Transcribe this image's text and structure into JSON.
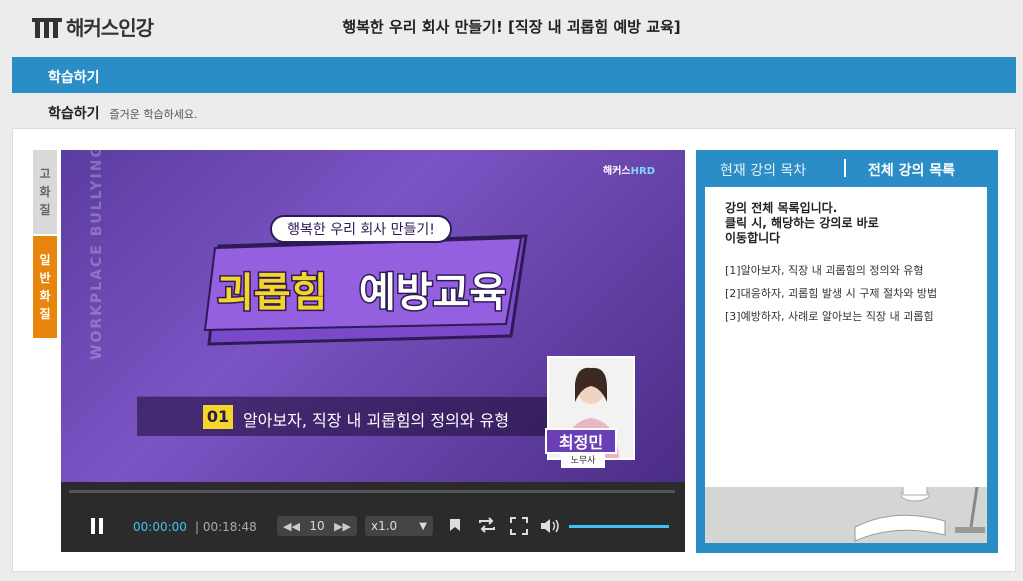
{
  "header": {
    "logo_text": "해커스인강",
    "title": "행복한 우리 회사 만들기! [직장 내 괴롭힘 예방 교육]"
  },
  "bluebar": {
    "label": "학습하기"
  },
  "subhead": {
    "title": "학습하기",
    "desc": "즐거운 학습하세요."
  },
  "quality": {
    "high": [
      "고",
      "화",
      "질"
    ],
    "normal": [
      "일",
      "반",
      "화",
      "질"
    ]
  },
  "video": {
    "slate_subtitle": "행복한 우리 회사 만들기!",
    "slate_title_part1": "괴롭힘",
    "slate_title_part2": "예방교육",
    "hrd_brand": "해커스",
    "hrd_accent": "HRD",
    "side_text": "WORKPLACE BULLYING",
    "lesson_number": "01",
    "lesson_title": "알아보자, 직장 내 괴롭힘의 정의와 유형",
    "presenter_name": "최정민",
    "presenter_role": "노무사"
  },
  "controls": {
    "current_time": "00:00:00",
    "duration": "| 00:18:48",
    "skip_seconds": "10",
    "speed": "x1.0",
    "progress": 0.0,
    "volume": 1.0
  },
  "list": {
    "tab_current": "현재 강의 목차",
    "tab_all": "전체 강의 목록",
    "intro_line1": "강의 전체 목록입니다.",
    "intro_line2": "클릭 시, 해당하는 강의로 바로",
    "intro_line3": "이동합니다",
    "items": [
      "[1]알아보자, 직장 내 괴롭힘의 정의와 유형",
      "[2]대응하자, 괴롭힘 발생 시 구제 절차와 방법",
      "[3]예방하자, 사례로 알아보는 직장 내 괴롭힘"
    ]
  },
  "colors": {
    "brand_blue": "#2a8dc6",
    "quality_active": "#e8850c",
    "accent_cyan": "#3fc4ef",
    "slate_yellow": "#f4d62a"
  }
}
